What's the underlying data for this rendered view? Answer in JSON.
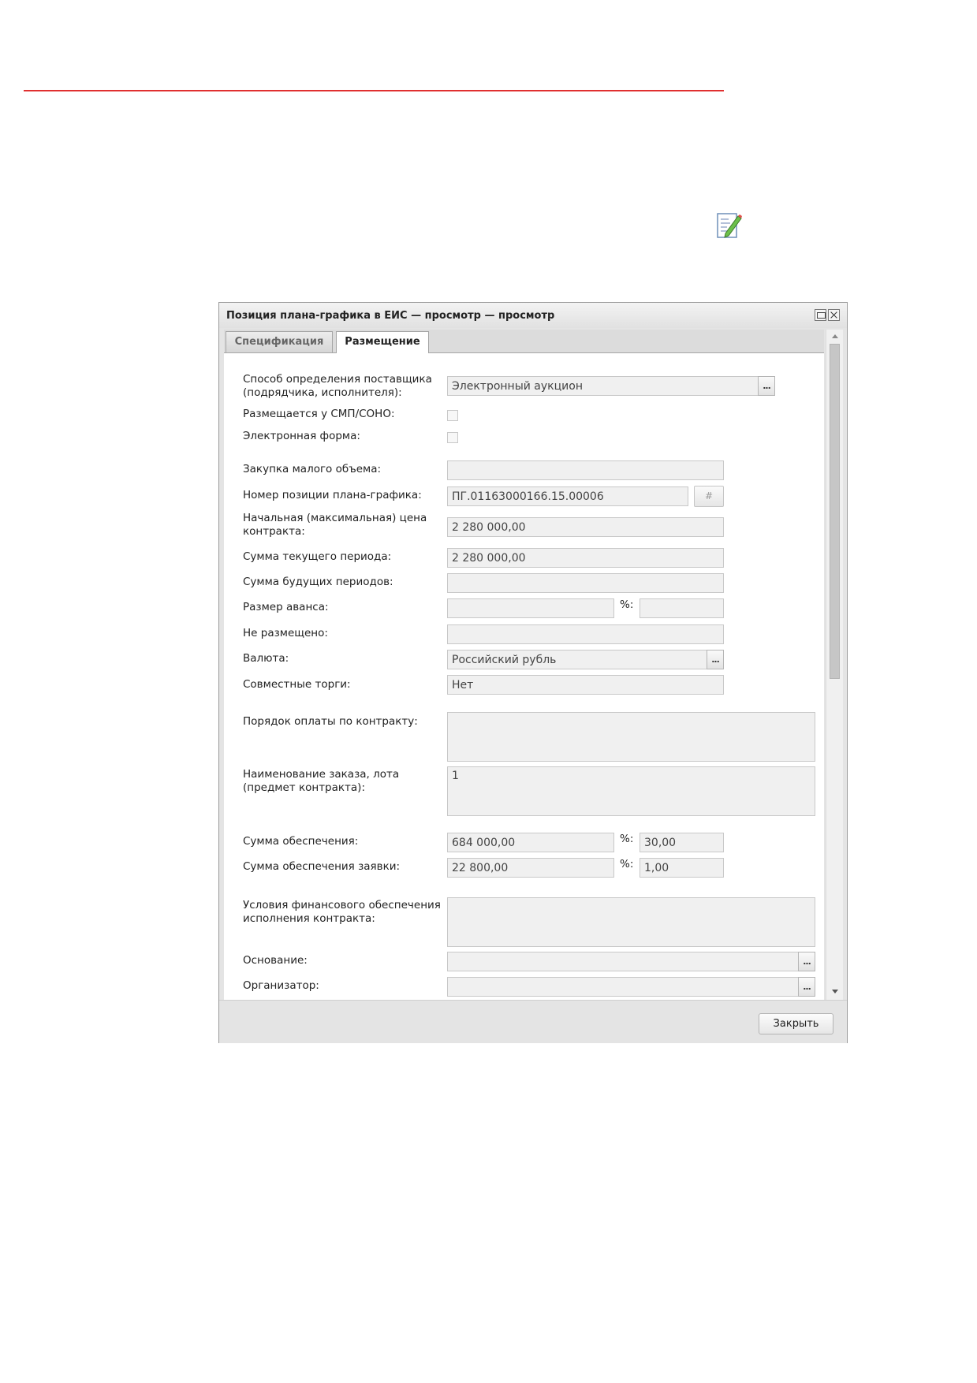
{
  "window": {
    "title": "Позиция плана-графика в ЕИС — просмотр — просмотр"
  },
  "tabs": [
    {
      "label": "Спецификация",
      "active": false
    },
    {
      "label": "Размещение",
      "active": true
    }
  ],
  "form": {
    "supplier_method": {
      "label": "Способ определения поставщика\n(подрядчика, исполнителя):",
      "value": "Электронный аукцион"
    },
    "smp_sono": {
      "label": "Размещается у СМП/СОНО:",
      "checked": false
    },
    "electronic_form": {
      "label": "Электронная форма:",
      "checked": false
    },
    "small_purchase": {
      "label": "Закупка малого объема:",
      "value": ""
    },
    "position_number": {
      "label": "Номер позиции плана-графика:",
      "value": "ПГ.01163000166.15.00006",
      "button": "#"
    },
    "initial_price": {
      "label": "Начальная (максимальная) цена\nконтракта:",
      "value": "2 280 000,00"
    },
    "current_period_sum": {
      "label": "Сумма текущего периода:",
      "value": "2 280 000,00"
    },
    "future_periods_sum": {
      "label": "Сумма будущих периодов:",
      "value": ""
    },
    "advance": {
      "label": "Размер аванса:",
      "value": "",
      "pct_label": "%:",
      "pct_value": ""
    },
    "not_placed": {
      "label": "Не размещено:",
      "value": ""
    },
    "currency": {
      "label": "Валюта:",
      "value": "Российский рубль"
    },
    "joint_bidding": {
      "label": "Совместные торги:",
      "value": "Нет"
    },
    "payment_order": {
      "label": "Порядок оплаты по контракту:",
      "value": ""
    },
    "order_name": {
      "label": "Наименование заказа, лота\n(предмет контракта):",
      "value": "1"
    },
    "security_sum": {
      "label": "Сумма обеспечения:",
      "value": "684 000,00",
      "pct_label": "%:",
      "pct_value": "30,00"
    },
    "bid_security_sum": {
      "label": "Сумма обеспечения заявки:",
      "value": "22 800,00",
      "pct_label": "%:",
      "pct_value": "1,00"
    },
    "financial_terms": {
      "label": "Условия финансового обеспечения\nисполнения контракта:",
      "value": ""
    },
    "basis": {
      "label": "Основание:",
      "value": ""
    },
    "organizer": {
      "label": "Организатор:",
      "value": ""
    },
    "ellipsis": "..."
  },
  "footer": {
    "close_label": "Закрыть"
  },
  "colors": {
    "rule": "#e03030",
    "field_bg": "#f0f0f0",
    "field_border": "#c8c8c8"
  },
  "icons": {
    "page_edit": "edit-page-icon"
  }
}
